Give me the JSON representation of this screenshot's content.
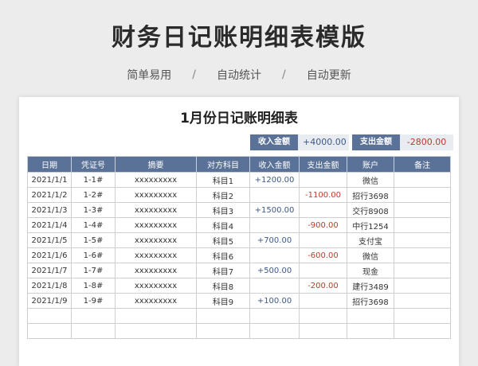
{
  "page": {
    "title": "财务日记账明细表模版",
    "tags": [
      "简单易用",
      "自动统计",
      "自动更新"
    ],
    "separator": "/"
  },
  "sheet": {
    "title": "1月份日记账明细表",
    "summary": {
      "income_label": "收入金额",
      "income_value": "+4000.00",
      "expense_label": "支出金额",
      "expense_value": "-2800.00"
    },
    "headers": [
      "日期",
      "凭证号",
      "摘要",
      "对方科目",
      "收入金额",
      "支出金额",
      "账户",
      "备注"
    ],
    "rows": [
      {
        "date": "2021/1/1",
        "voucher": "1-1#",
        "summary": "xxxxxxxxx",
        "subject": "科目1",
        "income": "+1200.00",
        "expense": "",
        "account": "微信",
        "note": ""
      },
      {
        "date": "2021/1/2",
        "voucher": "1-2#",
        "summary": "xxxxxxxxx",
        "subject": "科目2",
        "income": "",
        "expense": "-1100.00",
        "account": "招行3698",
        "note": ""
      },
      {
        "date": "2021/1/3",
        "voucher": "1-3#",
        "summary": "xxxxxxxxx",
        "subject": "科目3",
        "income": "+1500.00",
        "expense": "",
        "account": "交行8908",
        "note": ""
      },
      {
        "date": "2021/1/4",
        "voucher": "1-4#",
        "summary": "xxxxxxxxx",
        "subject": "科目4",
        "income": "",
        "expense": "-900.00",
        "account": "中行1254",
        "note": ""
      },
      {
        "date": "2021/1/5",
        "voucher": "1-5#",
        "summary": "xxxxxxxxx",
        "subject": "科目5",
        "income": "+700.00",
        "expense": "",
        "account": "支付宝",
        "note": ""
      },
      {
        "date": "2021/1/6",
        "voucher": "1-6#",
        "summary": "xxxxxxxxx",
        "subject": "科目6",
        "income": "",
        "expense": "-600.00",
        "account": "微信",
        "note": ""
      },
      {
        "date": "2021/1/7",
        "voucher": "1-7#",
        "summary": "xxxxxxxxx",
        "subject": "科目7",
        "income": "+500.00",
        "expense": "",
        "account": "现金",
        "note": ""
      },
      {
        "date": "2021/1/8",
        "voucher": "1-8#",
        "summary": "xxxxxxxxx",
        "subject": "科目8",
        "income": "",
        "expense": "-200.00",
        "account": "建行3489",
        "note": ""
      },
      {
        "date": "2021/1/9",
        "voucher": "1-9#",
        "summary": "xxxxxxxxx",
        "subject": "科目9",
        "income": "+100.00",
        "expense": "",
        "account": "招行3698",
        "note": ""
      },
      {
        "date": "",
        "voucher": "",
        "summary": "",
        "subject": "",
        "income": "",
        "expense": "",
        "account": "",
        "note": ""
      },
      {
        "date": "",
        "voucher": "",
        "summary": "",
        "subject": "",
        "income": "",
        "expense": "",
        "account": "",
        "note": ""
      }
    ]
  },
  "colors": {
    "header_bg": "#5a7298",
    "income": "#3d5a86",
    "expense": "#c0392b"
  }
}
